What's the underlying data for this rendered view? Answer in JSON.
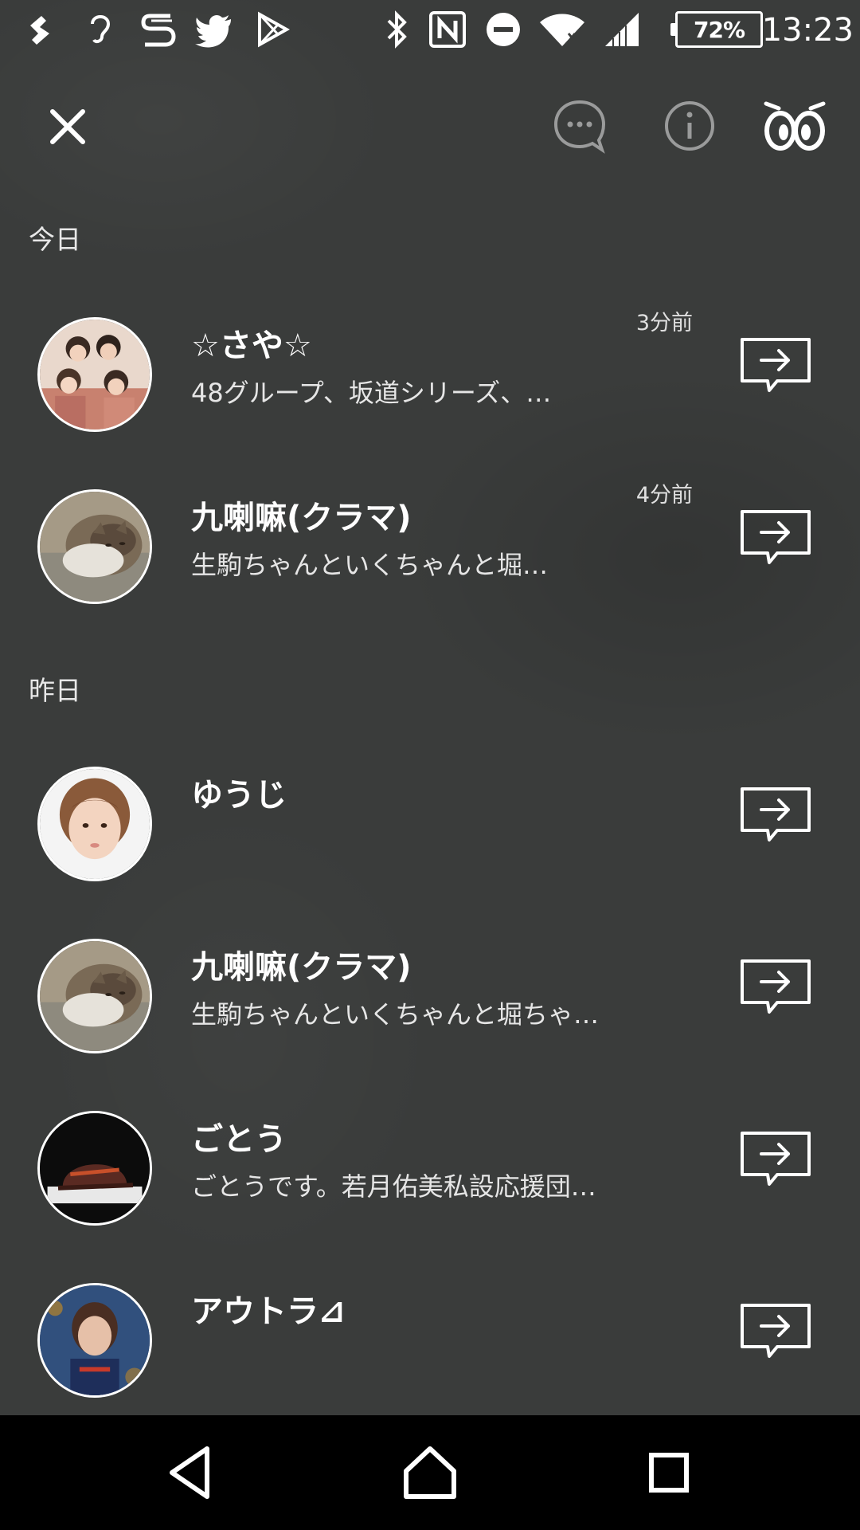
{
  "status_bar": {
    "battery": "72%",
    "time": "13:23",
    "left_icons": [
      "sound-icon",
      "hearing-icon",
      "s-app-icon",
      "twitter-icon",
      "play-store-icon"
    ],
    "right_icons": [
      "bluetooth-icon",
      "nfc-icon",
      "do-not-disturb-icon",
      "wifi-icon",
      "signal-icon"
    ]
  },
  "top_bar": {
    "close_icon": "close-icon",
    "chat_icon": "chat-bubble-icon",
    "info_icon": "info-icon",
    "eyes_icon": "eyes-icon"
  },
  "sections": [
    {
      "header": "今日",
      "items": [
        {
          "name": "☆さや☆",
          "preview": "48グループ、坂道シリーズ、…",
          "time": "3分前",
          "avatar": "group-photo"
        },
        {
          "name": "九喇嘛(クラマ)",
          "preview": "生駒ちゃんといくちゃんと堀…",
          "time": "4分前",
          "avatar": "cat-photo"
        }
      ]
    },
    {
      "header": "昨日",
      "items": [
        {
          "name": "ゆうじ",
          "preview": "",
          "time": "",
          "avatar": "portrait-photo"
        },
        {
          "name": "九喇嘛(クラマ)",
          "preview": "生駒ちゃんといくちゃんと堀ちゃ…",
          "time": "",
          "avatar": "cat-photo"
        },
        {
          "name": "ごとう",
          "preview": "ごとうです。若月佑美私設応援団…",
          "time": "",
          "avatar": "cap-photo"
        },
        {
          "name": "アウトラ⊿",
          "preview": "",
          "time": "",
          "avatar": "idol-photo"
        }
      ]
    }
  ],
  "row_action_icon": "share-forward-icon",
  "nav_bar": {
    "back": "back-icon",
    "home": "home-icon",
    "recents": "recents-icon"
  },
  "colors": {
    "background": "#3a3c3b",
    "text": "#ffffff",
    "muted": "#9a9b9b",
    "nav": "#000000"
  }
}
